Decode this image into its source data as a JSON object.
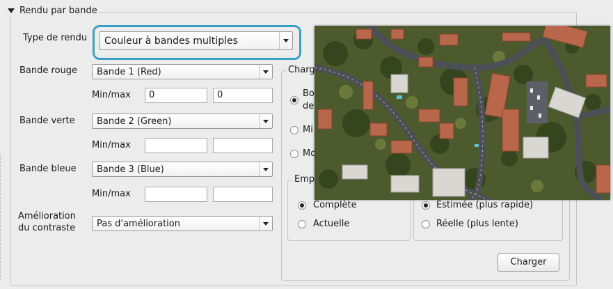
{
  "section": {
    "title": "Rendu par bande"
  },
  "render_type": {
    "label": "Type de rendu",
    "value": "Couleur à bandes multiples"
  },
  "red": {
    "label": "Bande rouge",
    "value": "Bande 1 (Red)",
    "minmax_label": "Min/max",
    "min": "0",
    "max": "0"
  },
  "green": {
    "label": "Bande verte",
    "value": "Bande 2 (Green)",
    "minmax_label": "Min/max",
    "min": "",
    "max": ""
  },
  "blue": {
    "label": "Bande bleue",
    "value": "Bande 3 (Blue)",
    "minmax_label": "Min/max",
    "min": "",
    "max": ""
  },
  "contrast": {
    "label_line1": "Amélioration",
    "label_line2": "du contraste",
    "value": "Pas d'amélioration"
  },
  "load_group": {
    "title": "Charg",
    "options": [
      "Bo",
      "de",
      "Mi",
      "Mo"
    ]
  },
  "extent_group": {
    "title": "Emp",
    "options": [
      "Complète",
      "Actuelle"
    ]
  },
  "accuracy_group": {
    "options": [
      "Estimée (plus rapide)",
      "Réelle (plus lente)"
    ]
  },
  "load_button": "Charger",
  "colors": {
    "focus": "#3aa0c4",
    "background": "#ececec"
  }
}
